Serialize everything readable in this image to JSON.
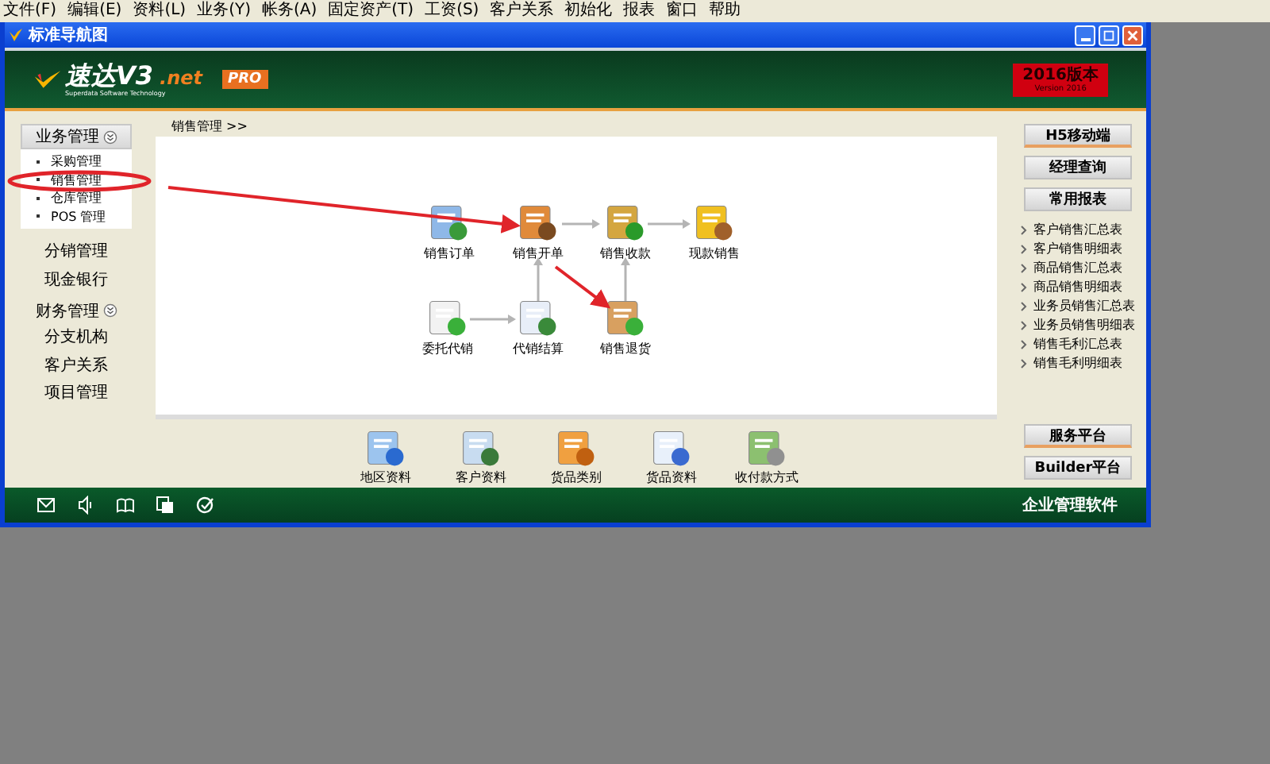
{
  "menu_bar": [
    "文件(F)",
    "编辑(E)",
    "资料(L)",
    "业务(Y)",
    "帐务(A)",
    "固定资产(T)",
    "工资(S)",
    "客户关系",
    "初始化",
    "报表",
    "窗口",
    "帮助"
  ],
  "window": {
    "title": "标准导航图"
  },
  "header": {
    "logo": "速达V3",
    "logo_suffix": ".net",
    "tagline": "Superdata Software Technology",
    "edition": "PRO",
    "version": "2016版本",
    "version_sub": "Version 2016"
  },
  "sidebar": [
    {
      "label": "业务管理",
      "kind": "group",
      "expanded": true,
      "children": [
        "采购管理",
        "销售管理",
        "仓库管理",
        "POS 管理"
      ]
    },
    {
      "label": "分销管理",
      "kind": "link"
    },
    {
      "label": "现金银行",
      "kind": "link"
    },
    {
      "label": "财务管理",
      "kind": "group",
      "expanded": false
    },
    {
      "label": "分支机构",
      "kind": "link"
    },
    {
      "label": "客户关系",
      "kind": "link"
    },
    {
      "label": "项目管理",
      "kind": "link"
    }
  ],
  "breadcrumb": "销售管理 >>",
  "flow_nodes": [
    "销售订单",
    "销售开单",
    "销售收款",
    "现款销售",
    "委托代销",
    "代销结算",
    "销售退货"
  ],
  "tools": [
    "地区资料",
    "客户资料",
    "货品类别",
    "货品资料",
    "收付款方式"
  ],
  "right_buttons": [
    "H5移动端",
    "经理查询",
    "常用报表"
  ],
  "reports": [
    "客户销售汇总表",
    "客户销售明细表",
    "商品销售汇总表",
    "商品销售明细表",
    "业务员销售汇总表",
    "业务员销售明细表",
    "销售毛利汇总表",
    "销售毛利明细表"
  ],
  "platform_buttons": [
    "服务平台",
    "Builder平台"
  ],
  "footer": {
    "text": "企业管理软件"
  }
}
